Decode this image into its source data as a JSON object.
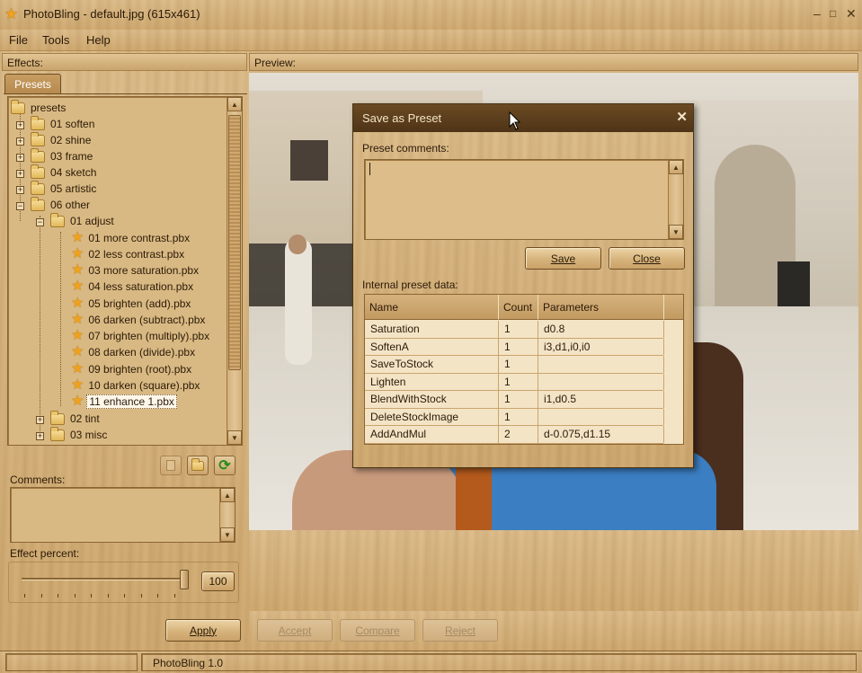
{
  "window": {
    "title": "PhotoBling - default.jpg (615x461)",
    "controls": {
      "minimize": "‒",
      "maximize": "□",
      "close": "✕"
    }
  },
  "menu": [
    "File",
    "Tools",
    "Help"
  ],
  "effects_panel": {
    "header": "Effects:",
    "tab": "Presets",
    "tree": [
      {
        "label": "presets",
        "type": "folder"
      },
      {
        "label": "01 soften",
        "type": "folder"
      },
      {
        "label": "02 shine",
        "type": "folder"
      },
      {
        "label": "03 frame",
        "type": "folder"
      },
      {
        "label": "04 sketch",
        "type": "folder"
      },
      {
        "label": "05 artistic",
        "type": "folder"
      },
      {
        "label": "06 other",
        "type": "folder"
      },
      {
        "label": "01 adjust",
        "type": "folder"
      },
      {
        "label": "01 more contrast.pbx",
        "type": "preset"
      },
      {
        "label": "02 less contrast.pbx",
        "type": "preset"
      },
      {
        "label": "03 more saturation.pbx",
        "type": "preset"
      },
      {
        "label": "04 less saturation.pbx",
        "type": "preset"
      },
      {
        "label": "05 brighten (add).pbx",
        "type": "preset"
      },
      {
        "label": "06 darken (subtract).pbx",
        "type": "preset"
      },
      {
        "label": "07 brighten (multiply).pbx",
        "type": "preset"
      },
      {
        "label": "08 darken (divide).pbx",
        "type": "preset"
      },
      {
        "label": "09 brighten (root).pbx",
        "type": "preset"
      },
      {
        "label": "10 darken (square).pbx",
        "type": "preset"
      },
      {
        "label": "11 enhance 1.pbx",
        "type": "preset",
        "selected": true
      },
      {
        "label": "02 tint",
        "type": "folder"
      },
      {
        "label": "03 misc",
        "type": "folder"
      }
    ],
    "comments_label": "Comments:",
    "comments_value": "",
    "effect_percent_label": "Effect percent:",
    "effect_percent": "100",
    "apply_label": "Apply"
  },
  "preview_panel": {
    "header": "Preview:",
    "accept_label": "Accept",
    "compare_label": "Compare",
    "reject_label": "Reject"
  },
  "status": {
    "left": "",
    "app_version": "PhotoBling 1.0"
  },
  "dialog": {
    "title": "Save as Preset",
    "comments_label": "Preset comments:",
    "comments_value": "",
    "save_label": "Save",
    "close_label": "Close",
    "internal_label": "Internal preset data:",
    "columns": [
      "Name",
      "Count",
      "Parameters"
    ],
    "rows": [
      {
        "name": "Saturation",
        "count": "1",
        "params": "d0.8"
      },
      {
        "name": "SoftenA",
        "count": "1",
        "params": "i3,d1,i0,i0"
      },
      {
        "name": "SaveToStock",
        "count": "1",
        "params": ""
      },
      {
        "name": "Lighten",
        "count": "1",
        "params": ""
      },
      {
        "name": "BlendWithStock",
        "count": "1",
        "params": "i1,d0.5"
      },
      {
        "name": "DeleteStockImage",
        "count": "1",
        "params": ""
      },
      {
        "name": "AddAndMul",
        "count": "2",
        "params": "d-0.075,d1.15"
      }
    ]
  },
  "colors": {
    "wood_light": "#dcbc8a",
    "wood_dark": "#c29a62",
    "dialog_title": "#4e3416",
    "star": "#f0a21c"
  }
}
